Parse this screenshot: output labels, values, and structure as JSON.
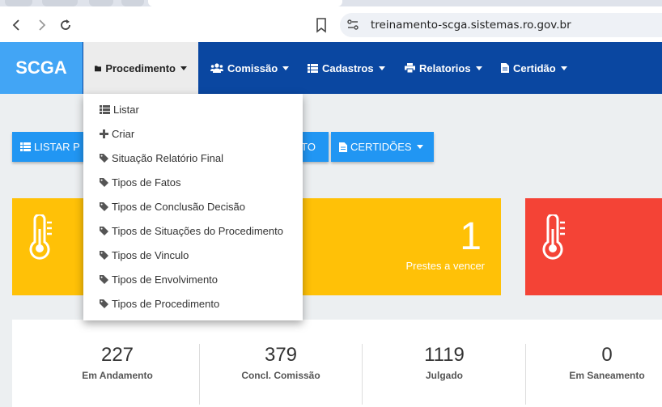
{
  "browser": {
    "url": "treinamento-scga.sistemas.ro.gov.br",
    "icons": [
      "back-icon",
      "forward-icon",
      "reload-icon",
      "bookmark-icon",
      "site-settings-icon"
    ]
  },
  "navbar": {
    "brand": "SCGA",
    "menu": [
      {
        "label": "Procedimento",
        "icon": "folder-icon"
      },
      {
        "label": "Comissão",
        "icon": "users-icon"
      },
      {
        "label": "Cadastros",
        "icon": "list-icon"
      },
      {
        "label": "Relatorios",
        "icon": "print-icon"
      },
      {
        "label": "Certidão",
        "icon": "file-icon"
      }
    ]
  },
  "dropdown": {
    "items": [
      {
        "label": "Listar",
        "icon": "list-icon"
      },
      {
        "label": "Criar",
        "icon": "plus-icon"
      },
      {
        "label": "Situação Relatório Final",
        "icon": "tag-icon"
      },
      {
        "label": "Tipos de Fatos",
        "icon": "tag-icon"
      },
      {
        "label": "Tipos de Conclusão Decisão",
        "icon": "tag-icon"
      },
      {
        "label": "Tipos de Situações do Procedimento",
        "icon": "tag-icon"
      },
      {
        "label": "Tipos de Vinculo",
        "icon": "tag-icon"
      },
      {
        "label": "Tipos de Envolvimento",
        "icon": "tag-icon"
      },
      {
        "label": "Tipos de Procedimento",
        "icon": "tag-icon"
      }
    ]
  },
  "actions": {
    "listar_label": "LISTAR P",
    "middle_label": "TO",
    "certidoes_label": "CERTIDÕES"
  },
  "cards": {
    "yellow": {
      "number": "1",
      "label": "Prestes a vencer",
      "color": "#ffc107"
    },
    "red": {
      "color": "#f44336"
    }
  },
  "stats": [
    {
      "value": "227",
      "label": "Em Andamento"
    },
    {
      "value": "379",
      "label": "Concl. Comissão"
    },
    {
      "value": "1119",
      "label": "Julgado"
    },
    {
      "value": "0",
      "label": "Em Saneamento"
    }
  ]
}
